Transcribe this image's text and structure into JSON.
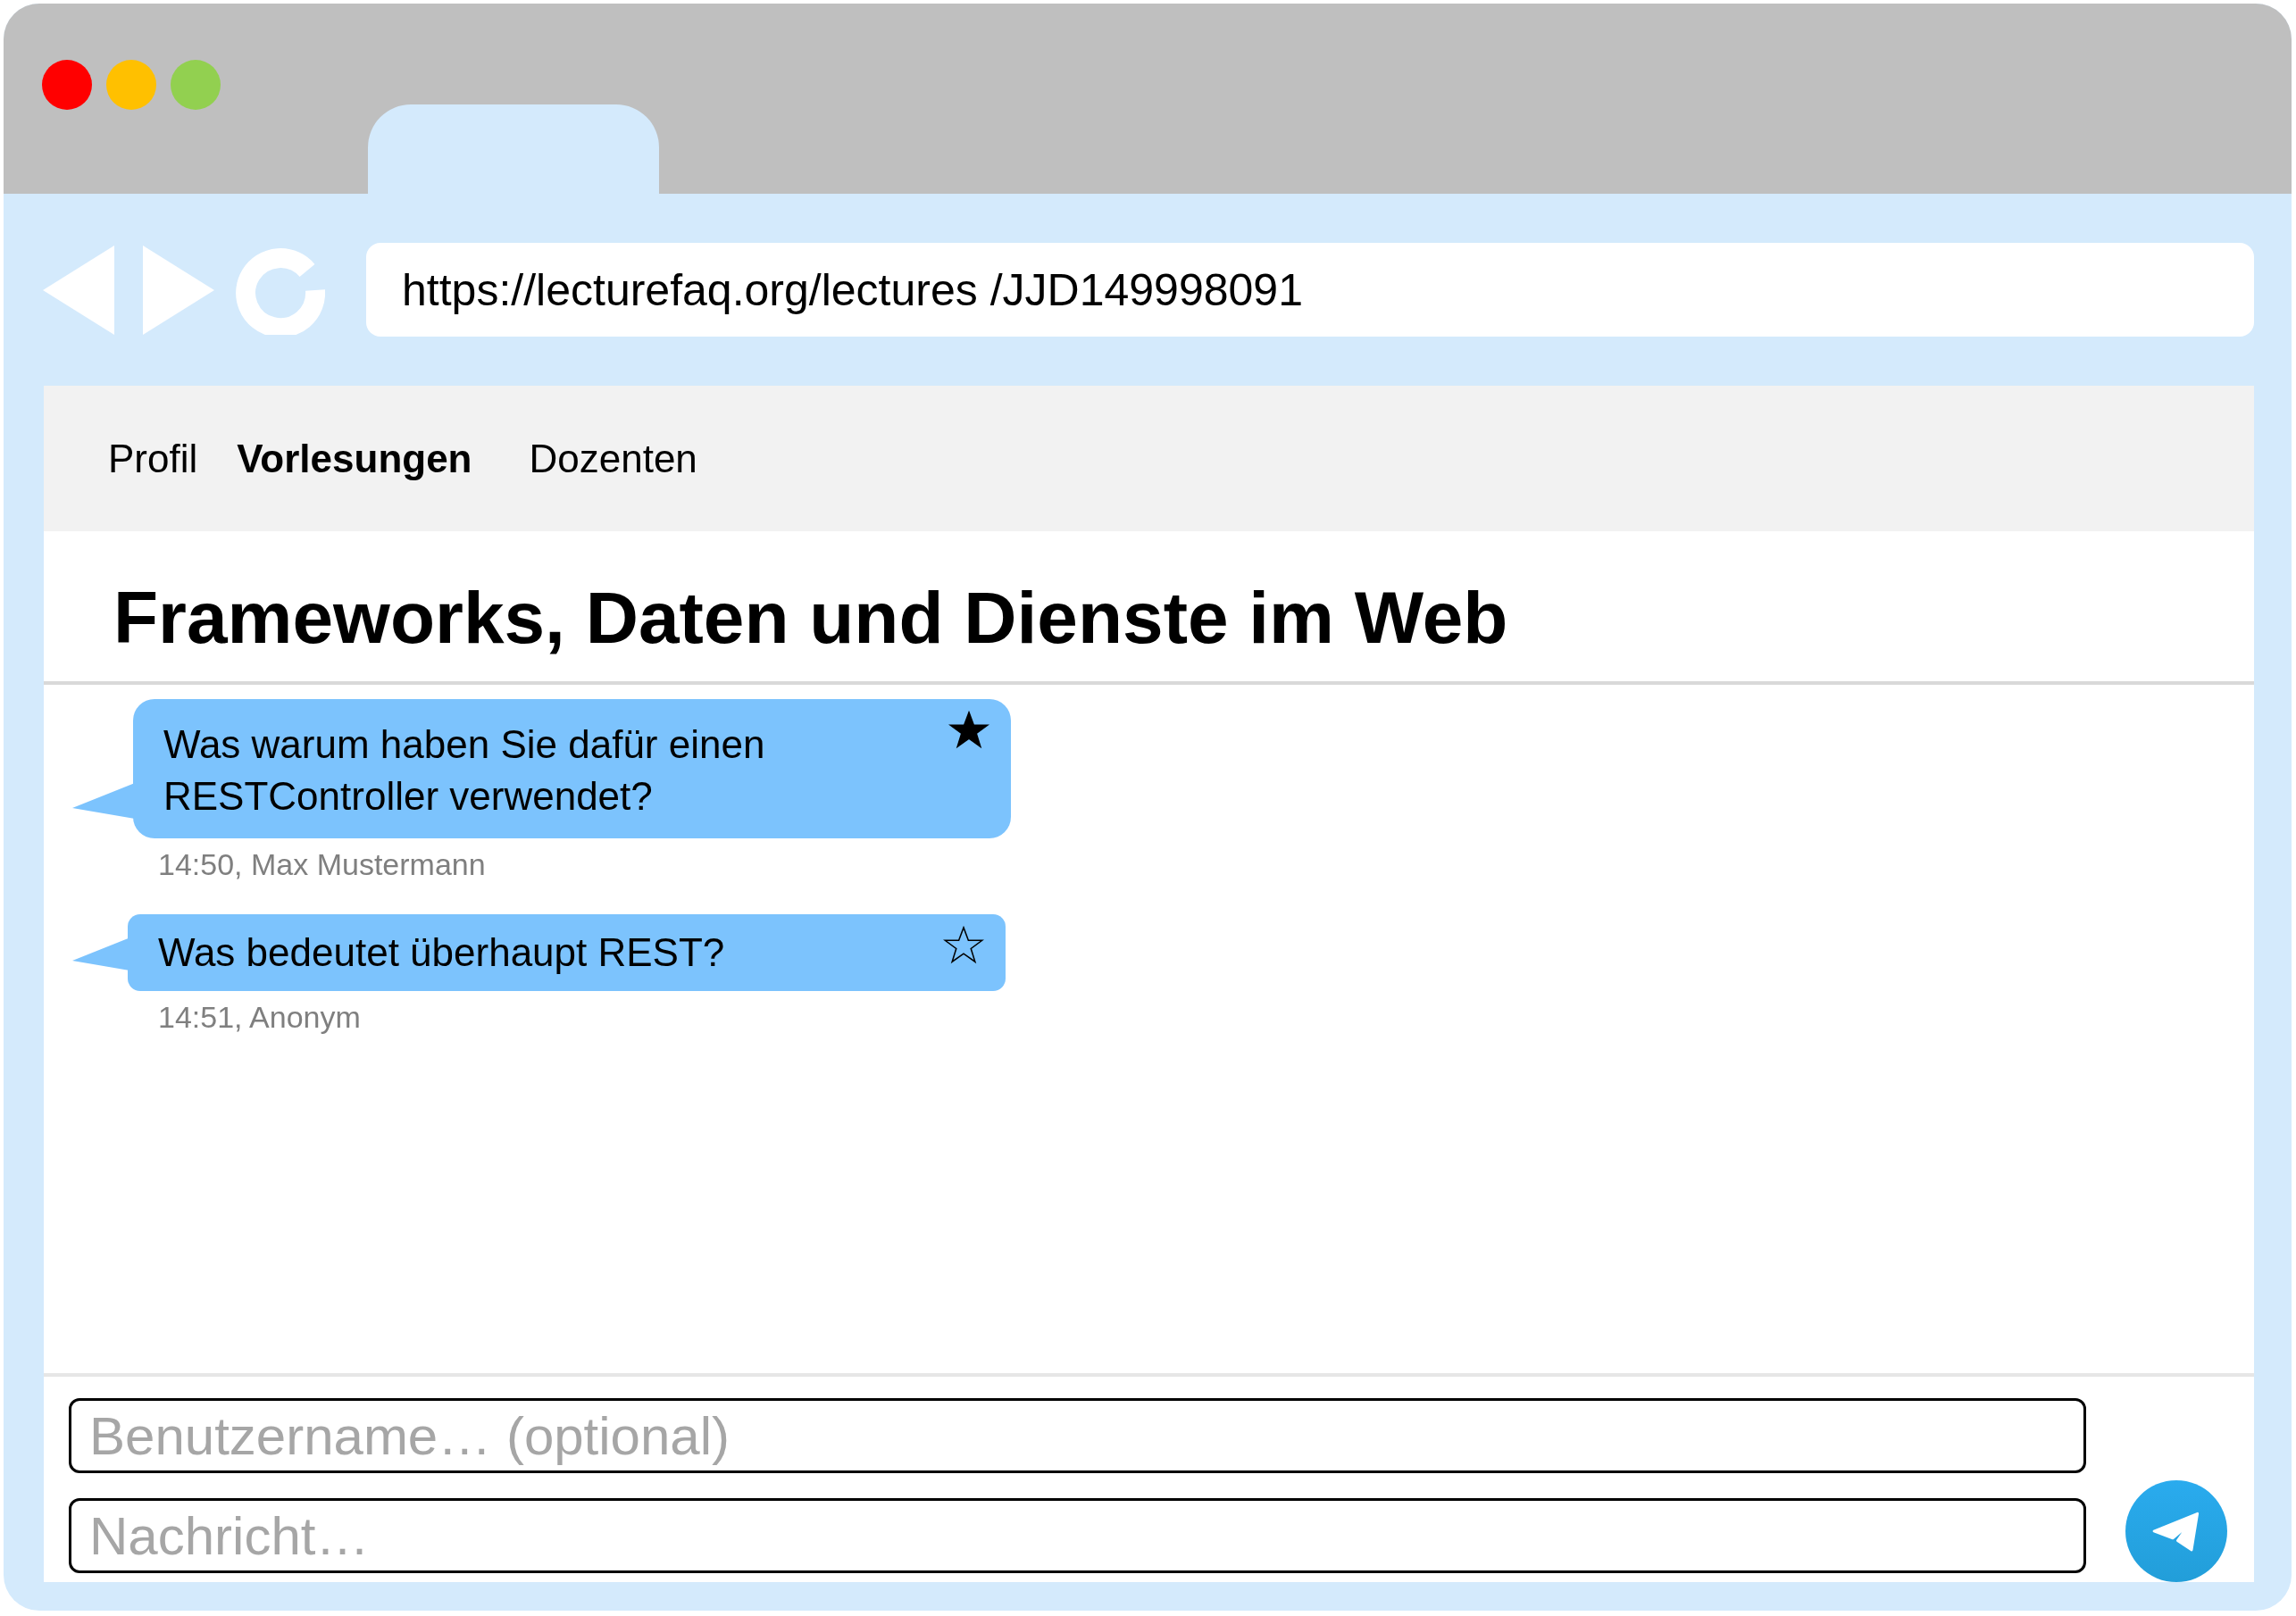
{
  "browser": {
    "url": "https://lecturefaq.org/lectures /JJD149998091"
  },
  "nav": [
    {
      "label": "Profil",
      "selected": false
    },
    {
      "label": "Vorlesungen",
      "selected": true
    },
    {
      "label": "Dozenten",
      "selected": false
    }
  ],
  "title": "Frameworks, Daten und Dienste im Web",
  "messages": [
    {
      "text": "Was warum haben Sie dafür einen RESTController verwendet?",
      "starred": true,
      "meta": "14:50, Max Mustermann"
    },
    {
      "text": "Was bedeutet überhaupt REST?",
      "starred": false,
      "meta": "14:51, Anonym"
    }
  ],
  "composer": {
    "name_placeholder": "Benutzername… (optional)",
    "message_placeholder": "Nachricht…"
  }
}
